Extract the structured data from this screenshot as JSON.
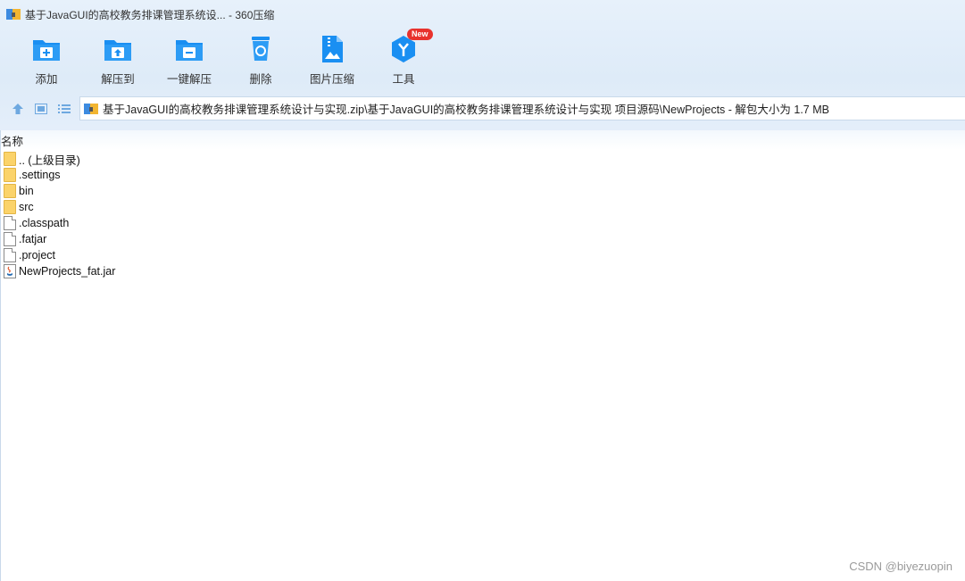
{
  "window": {
    "title": "基于JavaGUI的高校教务排课管理系统设... - 360压缩"
  },
  "toolbar": {
    "items": [
      {
        "label": "添加",
        "icon": "add-folder-icon"
      },
      {
        "label": "解压到",
        "icon": "extract-to-icon"
      },
      {
        "label": "一键解压",
        "icon": "one-click-extract-icon"
      },
      {
        "label": "删除",
        "icon": "delete-bin-icon"
      },
      {
        "label": "图片压缩",
        "icon": "image-compress-icon"
      },
      {
        "label": "工具",
        "icon": "tools-icon",
        "badge": "New"
      }
    ]
  },
  "nav": {
    "path": "基于JavaGUI的高校教务排课管理系统设计与实现.zip\\基于JavaGUI的高校教务排课管理系统设计与实现 项目源码\\NewProjects - 解包大小为 1.7 MB"
  },
  "list": {
    "column_name": "名称",
    "rows": [
      {
        "name": ".. (上级目录)",
        "type": "folder"
      },
      {
        "name": ".settings",
        "type": "folder"
      },
      {
        "name": "bin",
        "type": "folder"
      },
      {
        "name": "src",
        "type": "folder"
      },
      {
        "name": ".classpath",
        "type": "file"
      },
      {
        "name": ".fatjar",
        "type": "file"
      },
      {
        "name": ".project",
        "type": "file"
      },
      {
        "name": "NewProjects_fat.jar",
        "type": "jar"
      }
    ]
  },
  "watermark": "CSDN @biyezuopin",
  "colors": {
    "accent": "#1a8ff2",
    "folder": "#fbd36a",
    "badge": "#e8322d"
  }
}
